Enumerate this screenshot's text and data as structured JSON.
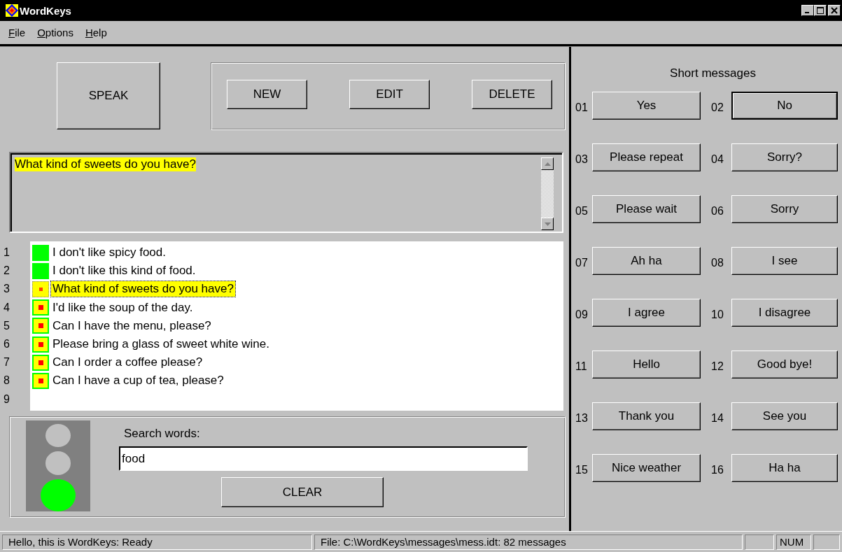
{
  "window": {
    "title": "WordKeys"
  },
  "menu": [
    {
      "label": "File"
    },
    {
      "label": "Options"
    },
    {
      "label": "Help"
    }
  ],
  "speak_button": "SPEAK",
  "edit_buttons": [
    "NEW",
    "EDIT",
    "DELETE"
  ],
  "message_box": {
    "value": "What kind of sweets do you have?"
  },
  "messages": [
    {
      "number": "1",
      "text": "I don't like spicy food.",
      "kind": "green",
      "selected": false
    },
    {
      "number": "2",
      "text": "I don't like this kind of food.",
      "kind": "green",
      "selected": false
    },
    {
      "number": "3",
      "text": "What kind of sweets do you have?",
      "kind": "red",
      "selected": true
    },
    {
      "number": "4",
      "text": "I'd like the soup of the day.",
      "kind": "red",
      "selected": false
    },
    {
      "number": "5",
      "text": "Can I have the menu, please?",
      "kind": "red",
      "selected": false
    },
    {
      "number": "6",
      "text": "Please bring a glass of sweet white wine.",
      "kind": "red",
      "selected": false
    },
    {
      "number": "7",
      "text": "Can I order a coffee please?",
      "kind": "red",
      "selected": false
    },
    {
      "number": "8",
      "text": "Can I have a cup of tea, please?",
      "kind": "red",
      "selected": false
    },
    {
      "number": "9"
    }
  ],
  "traffic_light": [
    {
      "on": false
    },
    {
      "on": false
    },
    {
      "on": true
    }
  ],
  "search": {
    "label": "Search words:",
    "value": "food",
    "clear_button": "CLEAR"
  },
  "short_messages": {
    "title": "Short messages",
    "items": [
      {
        "number": "01",
        "label": "Yes",
        "focused": false
      },
      {
        "number": "02",
        "label": "No",
        "focused": true
      },
      {
        "number": "03",
        "label": "Please repeat",
        "focused": false
      },
      {
        "number": "04",
        "label": "Sorry?",
        "focused": false
      },
      {
        "number": "05",
        "label": "Please wait",
        "focused": false
      },
      {
        "number": "06",
        "label": "Sorry",
        "focused": false
      },
      {
        "number": "07",
        "label": "Ah ha",
        "focused": false
      },
      {
        "number": "08",
        "label": "I see",
        "focused": false
      },
      {
        "number": "09",
        "label": "I agree",
        "focused": false
      },
      {
        "number": "10",
        "label": "I disagree",
        "focused": false
      },
      {
        "number": "11",
        "label": "Hello",
        "focused": false
      },
      {
        "number": "12",
        "label": "Good bye!",
        "focused": false
      },
      {
        "number": "13",
        "label": "Thank you",
        "focused": false
      },
      {
        "number": "14",
        "label": "See you",
        "focused": false
      },
      {
        "number": "15",
        "label": "Nice weather",
        "focused": false
      },
      {
        "number": "16",
        "label": "Ha ha",
        "focused": false
      }
    ]
  },
  "status_bar": [
    {
      "kind": "text",
      "text": "Hello, this is WordKeys: Ready"
    },
    {
      "kind": "text",
      "text": "File: C:\\WordKeys\\messages\\mess.idt: 82 messages"
    },
    {
      "kind": "blank"
    },
    {
      "kind": "text",
      "text": "NUM"
    },
    {
      "kind": "blank"
    }
  ]
}
